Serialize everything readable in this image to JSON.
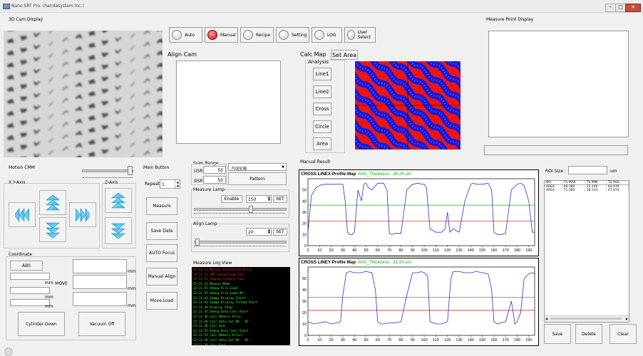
{
  "title": "Nano SRT Pro. (handasystem Inc.)",
  "labels": {
    "cam3d": "3D Cam Display",
    "align_cam": "Align Cam",
    "calc_map": "Calc Map",
    "measure_point": "Measure Point Display",
    "motion_cmm": "Motion CMM",
    "main_button": "Main Button",
    "xy_axis": "X,Y-Axis",
    "z_axis": "Z-Axis",
    "coordinate": "Coordinate",
    "repeat": "Repeat :",
    "scan_range": "Scan Range",
    "usr": "USR",
    "dsr": "DSR",
    "measure_lamp": "Measure Lamp",
    "align_lamp": "Align Lamp",
    "measure_log": "Measure Log View",
    "manual_result": "Manual Result",
    "roi_size": "ROI Size :",
    "roi_unit": "um",
    "analysis": "Analysis",
    "mm": "mm"
  },
  "top_buttons": [
    {
      "label": "Auto",
      "on": false
    },
    {
      "label": "Manual",
      "on": true
    },
    {
      "label": "Recipe",
      "on": false
    },
    {
      "label": "Setting",
      "on": false
    },
    {
      "label": "LOG",
      "on": false
    },
    {
      "label": "User Select",
      "on": false
    }
  ],
  "set_area": "Set Area",
  "analysis_buttons": [
    "Line1",
    "Line2",
    "Cross",
    "Circle",
    "Area"
  ],
  "main_buttons": [
    "Measure",
    "Save Data",
    "AUTO Focus",
    "Manual Align",
    "Move Load"
  ],
  "repeat_value": "1",
  "usr_value": "50",
  "dsr_value": "50",
  "pattern_select": "기대모패",
  "pattern_button": "Pattern",
  "measure_lamp": {
    "enable": "Enable",
    "value": "150",
    "set": "SET"
  },
  "align_lamp": {
    "value": "20",
    "set": "SET"
  },
  "coord": {
    "abs": "ABS",
    "move": "MOVE",
    "cylinder": "Cylinder Down",
    "vacuum": "Vacuum Off"
  },
  "log_lines": [
    {
      "t": "22:11:23_Motion Initialize Error",
      "c": "#ff3030"
    },
    {
      "t": "22:11:23_SRT Connecting Fail",
      "c": "#ff3030"
    },
    {
      "t": "22:11:23_Cognex Connect Fail",
      "c": "#ff3030"
    },
    {
      "t": "22:11:23_Manual Mode",
      "c": "#40ff40"
    },
    {
      "t": "22:11:25_Debug File Load",
      "c": "#40ff40"
    },
    {
      "t": "22:11:35_Debug File Load OK!",
      "c": "#40ff40"
    },
    {
      "t": "22:11:42_Image Display Start!",
      "c": "#40ff40"
    },
    {
      "t": "22:11:42_Image Display Thread Start",
      "c": "#40ff40"
    },
    {
      "t": "22:11:44_Display Stop!",
      "c": "#40ff40"
    },
    {
      "t": "22:11:45_Debug Data Calc Start",
      "c": "#40ff40"
    },
    {
      "t": "22:11:46_Calc Memory Alloc",
      "c": "#40ff40"
    },
    {
      "t": "22:11:46_Calc Data Set OK - 85",
      "c": "#40ff40"
    },
    {
      "t": "22:11:46_Calc End!",
      "c": "#40ff40"
    },
    {
      "t": "22:11:55_Debug Data Calc Start",
      "c": "#40ff40"
    },
    {
      "t": "22:11:55_Calc Memory Alloc!",
      "c": "#40ff40"
    },
    {
      "t": "22:11:56_Calc Data Set OK - 85",
      "c": "#40ff40"
    },
    {
      "t": "22:11:58_Calc End!",
      "c": "#40ff40"
    }
  ],
  "table": {
    "headers": [
      "NO.",
      "TS MAX",
      "TS MIN",
      "TS AVG"
    ],
    "rows": [
      [
        "AREA",
        "69.180",
        "25.146",
        "60.079"
      ],
      [
        "AREA",
        "71.360",
        "18.314",
        "47.674"
      ]
    ]
  },
  "bottom_buttons": [
    "Save",
    "Delete",
    "Clear"
  ],
  "chart_data": [
    {
      "type": "line",
      "title": "CROSS LINEX-Profile Map",
      "subtitle": "AVG_Thickness : 36.28 um",
      "xlim": [
        0,
        195
      ],
      "ylim": [
        0,
        60
      ],
      "xticks": [
        0,
        10,
        20,
        30,
        40,
        50,
        60,
        70,
        80,
        90,
        100,
        110,
        120,
        130,
        140,
        150,
        160,
        170,
        180,
        190
      ],
      "yticks": [
        0,
        10,
        20,
        30,
        40,
        50
      ],
      "colors": {
        "profile": "#3030c8",
        "avg": "#00c000",
        "ref": "#e03030"
      },
      "ref_lines": [
        {
          "y": 36.3,
          "color": "#00c000"
        },
        {
          "y": 22,
          "color": "#e03030"
        }
      ],
      "series": [
        {
          "x": [
            0,
            3,
            7,
            10,
            14,
            18,
            22,
            26,
            30,
            32,
            34,
            36,
            38,
            40,
            43,
            46,
            48,
            50,
            52,
            55,
            60,
            65,
            68,
            70,
            72,
            75,
            80,
            85,
            90,
            95,
            98,
            100,
            102,
            105,
            110,
            115,
            118,
            120,
            122,
            125,
            130,
            135,
            140,
            142,
            145,
            150,
            155,
            158,
            160,
            163,
            166,
            170,
            175,
            180,
            183,
            186,
            190,
            193,
            195
          ],
          "y": [
            12,
            45,
            52,
            54,
            55,
            55,
            55,
            55,
            55,
            40,
            12,
            10,
            10,
            12,
            50,
            40,
            55,
            56,
            52,
            50,
            56,
            56,
            50,
            11,
            10,
            11,
            11,
            50,
            55,
            56,
            55,
            55,
            52,
            15,
            12,
            12,
            15,
            30,
            12,
            15,
            12,
            40,
            55,
            56,
            55,
            55,
            56,
            50,
            12,
            10,
            10,
            11,
            50,
            55,
            56,
            54,
            40,
            12,
            12
          ]
        }
      ]
    },
    {
      "type": "line",
      "title": "CROSS LINEY-Profile Map",
      "subtitle": "AVG_Thickness : 33.33 um",
      "xlim": [
        0,
        195
      ],
      "ylim": [
        0,
        60
      ],
      "xticks": [
        0,
        10,
        20,
        30,
        40,
        50,
        60,
        70,
        80,
        90,
        100,
        110,
        120,
        130,
        140,
        150,
        160,
        170,
        180,
        190
      ],
      "yticks": [
        0,
        10,
        20,
        30,
        40,
        50
      ],
      "colors": {
        "profile": "#3030c8",
        "avg": "#00c000",
        "ref": "#e03030"
      },
      "ref_lines": [
        {
          "y": 33.3,
          "color": "#00c000"
        },
        {
          "y": 22,
          "color": "#e03030"
        }
      ],
      "series": [
        {
          "x": [
            0,
            5,
            10,
            15,
            20,
            25,
            28,
            30,
            33,
            36,
            40,
            45,
            50,
            55,
            58,
            60,
            63,
            65,
            70,
            75,
            80,
            85,
            90,
            95,
            97,
            100,
            103,
            105,
            110,
            115,
            118,
            120,
            123,
            125,
            130,
            135,
            140,
            145,
            150,
            155,
            158,
            160,
            163,
            166,
            170,
            175,
            178,
            180,
            183,
            186,
            190,
            193,
            195
          ],
          "y": [
            12,
            10,
            11,
            12,
            10,
            11,
            12,
            35,
            55,
            56,
            55,
            55,
            56,
            55,
            40,
            12,
            10,
            10,
            11,
            11,
            12,
            35,
            55,
            55,
            56,
            55,
            52,
            12,
            10,
            10,
            11,
            12,
            50,
            56,
            56,
            55,
            55,
            56,
            55,
            54,
            40,
            12,
            10,
            11,
            12,
            30,
            10,
            12,
            20,
            50,
            54,
            55,
            54
          ]
        }
      ]
    }
  ]
}
